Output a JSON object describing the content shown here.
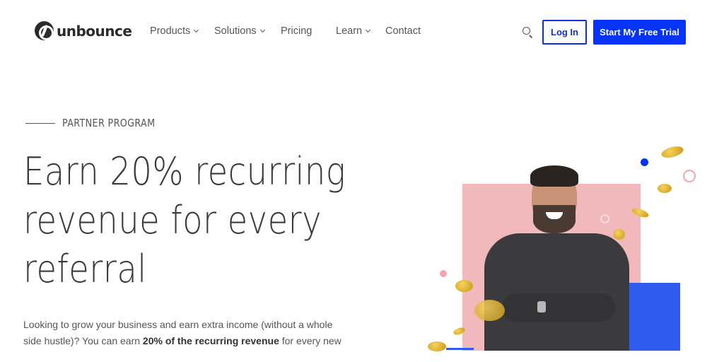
{
  "brand": {
    "name": "unbounce",
    "accent": "#0533f7"
  },
  "nav": {
    "items": [
      {
        "label": "Products",
        "has_dropdown": true
      },
      {
        "label": "Solutions",
        "has_dropdown": true
      },
      {
        "label": "Pricing",
        "has_dropdown": false
      },
      {
        "label": "Learn",
        "has_dropdown": true
      },
      {
        "label": "Contact",
        "has_dropdown": false
      }
    ],
    "search_icon": "search-icon",
    "login_label": "Log In",
    "trial_label": "Start My Free Trial"
  },
  "hero": {
    "eyebrow": "PARTNER PROGRAM",
    "headline_lines": [
      "Earn 20% recurring",
      "revenue for every",
      "referral"
    ],
    "body_pre": "Looking to grow your business and earn extra income (without a whole side hustle)? You can earn ",
    "body_bold": "20% of the recurring revenue",
    "body_post": " for every new",
    "image_alt": "Smiling man with crossed arms surrounded by falling gold coins"
  }
}
